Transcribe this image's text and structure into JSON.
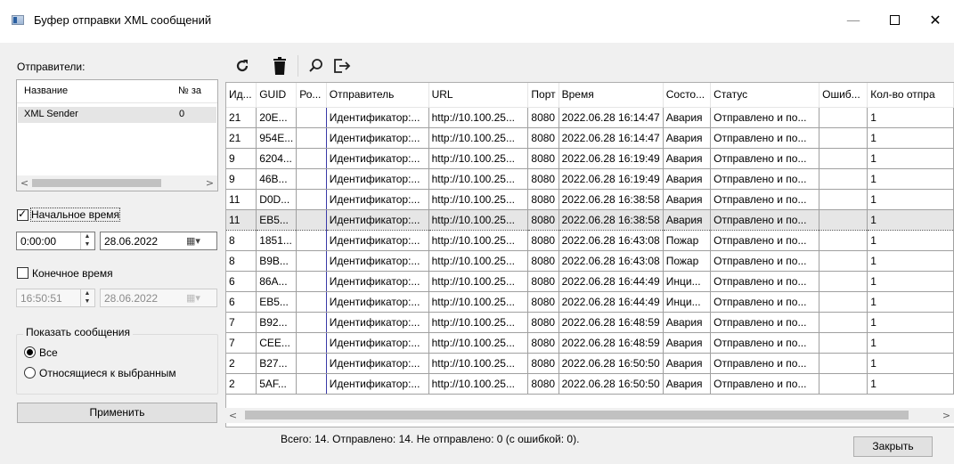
{
  "window": {
    "title": "Буфер отправки XML сообщений",
    "min": "—",
    "close": "✕"
  },
  "senders": {
    "label": "Отправители:",
    "columns": [
      "Название",
      "№ за"
    ],
    "rows": [
      {
        "name": "XML Sender",
        "num": "0"
      }
    ],
    "scroll_left": "<",
    "scroll_right": ">"
  },
  "filters": {
    "start_label": "Начальное время",
    "start_checked": true,
    "start_time": "0:00:00",
    "start_date": "28.06.2022",
    "end_label": "Конечное время",
    "end_checked": false,
    "end_time": "16:50:51",
    "end_date": "28.06.2022"
  },
  "show": {
    "title": "Показать сообщения",
    "all": "Все",
    "selected": "Относящиеся к выбранным"
  },
  "apply_label": "Применить",
  "toolbar": {
    "refresh": "refresh-icon",
    "delete": "trash-icon",
    "search": "search-icon",
    "export": "export-icon"
  },
  "grid": {
    "columns": [
      "Ид...",
      "GUID",
      "Ро...",
      "Отправитель",
      "URL",
      "Порт",
      "Время",
      "Состо...",
      "Статус",
      "Ошиб...",
      "Кол-во отпра"
    ],
    "rows": [
      [
        "21",
        "20E...",
        "",
        "Идентификатор:...",
        "http://10.100.25...",
        "8080",
        "2022.06.28 16:14:47",
        "Авария",
        "Отправлено и по...",
        "",
        "1"
      ],
      [
        "21",
        "954E...",
        "",
        "Идентификатор:...",
        "http://10.100.25...",
        "8080",
        "2022.06.28 16:14:47",
        "Авария",
        "Отправлено и по...",
        "",
        "1"
      ],
      [
        "9",
        "6204...",
        "",
        "Идентификатор:...",
        "http://10.100.25...",
        "8080",
        "2022.06.28 16:19:49",
        "Авария",
        "Отправлено и по...",
        "",
        "1"
      ],
      [
        "9",
        "46B...",
        "",
        "Идентификатор:...",
        "http://10.100.25...",
        "8080",
        "2022.06.28 16:19:49",
        "Авария",
        "Отправлено и по...",
        "",
        "1"
      ],
      [
        "11",
        "D0D...",
        "",
        "Идентификатор:...",
        "http://10.100.25...",
        "8080",
        "2022.06.28 16:38:58",
        "Авария",
        "Отправлено и по...",
        "",
        "1"
      ],
      [
        "11",
        "EB5...",
        "",
        "Идентификатор:...",
        "http://10.100.25...",
        "8080",
        "2022.06.28 16:38:58",
        "Авария",
        "Отправлено и по...",
        "",
        "1"
      ],
      [
        "8",
        "1851...",
        "",
        "Идентификатор:...",
        "http://10.100.25...",
        "8080",
        "2022.06.28 16:43:08",
        "Пожар",
        "Отправлено и по...",
        "",
        "1"
      ],
      [
        "8",
        "B9B...",
        "",
        "Идентификатор:...",
        "http://10.100.25...",
        "8080",
        "2022.06.28 16:43:08",
        "Пожар",
        "Отправлено и по...",
        "",
        "1"
      ],
      [
        "6",
        "86A...",
        "",
        "Идентификатор:...",
        "http://10.100.25...",
        "8080",
        "2022.06.28 16:44:49",
        "Инци...",
        "Отправлено и по...",
        "",
        "1"
      ],
      [
        "6",
        "EB5...",
        "",
        "Идентификатор:...",
        "http://10.100.25...",
        "8080",
        "2022.06.28 16:44:49",
        "Инци...",
        "Отправлено и по...",
        "",
        "1"
      ],
      [
        "7",
        "B92...",
        "",
        "Идентификатор:...",
        "http://10.100.25...",
        "8080",
        "2022.06.28 16:48:59",
        "Авария",
        "Отправлено и по...",
        "",
        "1"
      ],
      [
        "7",
        "CEE...",
        "",
        "Идентификатор:...",
        "http://10.100.25...",
        "8080",
        "2022.06.28 16:48:59",
        "Авария",
        "Отправлено и по...",
        "",
        "1"
      ],
      [
        "2",
        "B27...",
        "",
        "Идентификатор:...",
        "http://10.100.25...",
        "8080",
        "2022.06.28 16:50:50",
        "Авария",
        "Отправлено и по...",
        "",
        "1"
      ],
      [
        "2",
        "5AF...",
        "",
        "Идентификатор:...",
        "http://10.100.25...",
        "8080",
        "2022.06.28 16:50:50",
        "Авария",
        "Отправлено и по...",
        "",
        "1"
      ]
    ],
    "selected_row": 5,
    "scroll_left": "<",
    "scroll_right": ">"
  },
  "status_text": "Всего: 14. Отправлено: 14. Не отправлено: 0 (с ошибкой: 0).",
  "close_label": "Закрыть"
}
